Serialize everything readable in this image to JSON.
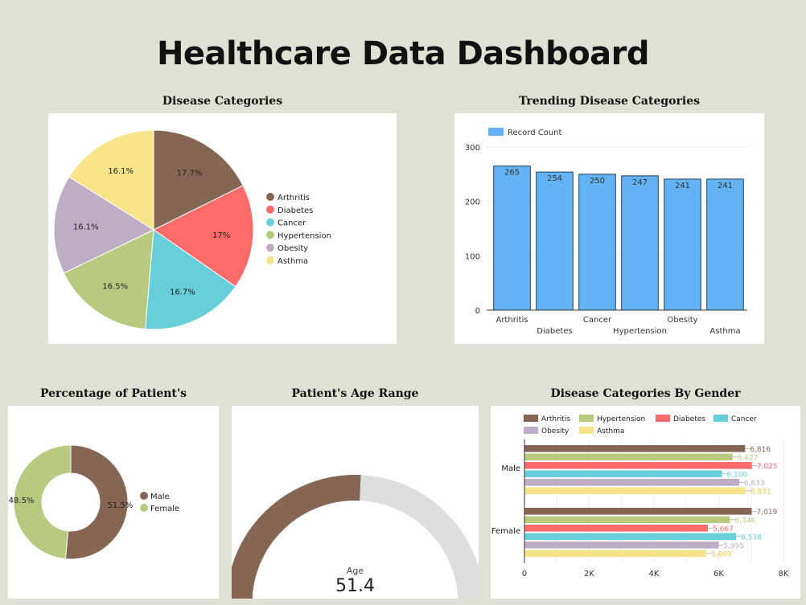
{
  "dashboard": {
    "title": "Healthcare Data Dashboard"
  },
  "colors": {
    "Arthritis": "#856654",
    "Diabetes": "#ff6b6b",
    "Cancer": "#67cfd9",
    "Hypertension": "#b8ca80",
    "Obesity": "#beadc4",
    "Asthma": "#f6e488",
    "bar_blue": "#62b2f4",
    "male": "#856654",
    "female": "#b8ca80",
    "gauge_track": "#dedede"
  },
  "chart_data": [
    {
      "id": "disease-categories",
      "type": "pie",
      "title": "Disease Categories",
      "labels": [
        "Arthritis",
        "Diabetes",
        "Cancer",
        "Hypertension",
        "Obesity",
        "Asthma"
      ],
      "values": [
        17.7,
        17,
        16.7,
        16.5,
        16.1,
        16.1
      ],
      "value_labels": [
        "17.7%",
        "17%",
        "16.7%",
        "16.5%",
        "16.1%",
        "16.1%"
      ],
      "legend": "right"
    },
    {
      "id": "trending-disease-categories",
      "type": "bar",
      "title": "Trending Disease Categories",
      "categories": [
        "Arthritis",
        "Diabetes",
        "Cancer",
        "Hypertension",
        "Obesity",
        "Asthma"
      ],
      "series": [
        {
          "name": "Record Count",
          "values": [
            265,
            254,
            250,
            247,
            241,
            241
          ]
        }
      ],
      "ylim": [
        0,
        300
      ],
      "yticks": [
        "0",
        "100",
        "200",
        "300"
      ],
      "legend": "top-left",
      "grid": true
    },
    {
      "id": "percentage-of-patients",
      "type": "pie",
      "donut": true,
      "title": "Percentage of Patient's",
      "labels": [
        "Male",
        "Female"
      ],
      "values": [
        51.5,
        48.5
      ],
      "value_labels": [
        "51.5%",
        "48.5%"
      ],
      "legend": "right"
    },
    {
      "id": "patients-age-range",
      "type": "gauge",
      "title": "Patient's Age Range",
      "label": "Age",
      "value": 51.4,
      "value_text": "51.4",
      "fill_fraction": 0.514
    },
    {
      "id": "disease-categories-by-gender",
      "type": "bar",
      "orientation": "horizontal",
      "title": "Disease Categories By Gender",
      "categories": [
        "Male",
        "Female"
      ],
      "series": [
        {
          "name": "Arthritis",
          "values": [
            6816,
            7019
          ],
          "labels": [
            "6,816",
            "7,019"
          ]
        },
        {
          "name": "Hypertension",
          "values": [
            6427,
            6346
          ],
          "labels": [
            "6,427",
            "6,346"
          ]
        },
        {
          "name": "Diabetes",
          "values": [
            7025,
            5667
          ],
          "labels": [
            "7,025",
            "5,667"
          ]
        },
        {
          "name": "Cancer",
          "values": [
            6100,
            6538
          ],
          "labels": [
            "6,100",
            "6,538"
          ]
        },
        {
          "name": "Obesity",
          "values": [
            6633,
            5995
          ],
          "labels": [
            "6,633",
            "5,995"
          ]
        },
        {
          "name": "Asthma",
          "values": [
            6831,
            5609
          ],
          "labels": [
            "6,831",
            "5,609"
          ]
        }
      ],
      "xlim": [
        0,
        8000
      ],
      "xticks": [
        "0",
        "2K",
        "4K",
        "6K",
        "8K"
      ],
      "legend": "top",
      "grid": true
    }
  ]
}
